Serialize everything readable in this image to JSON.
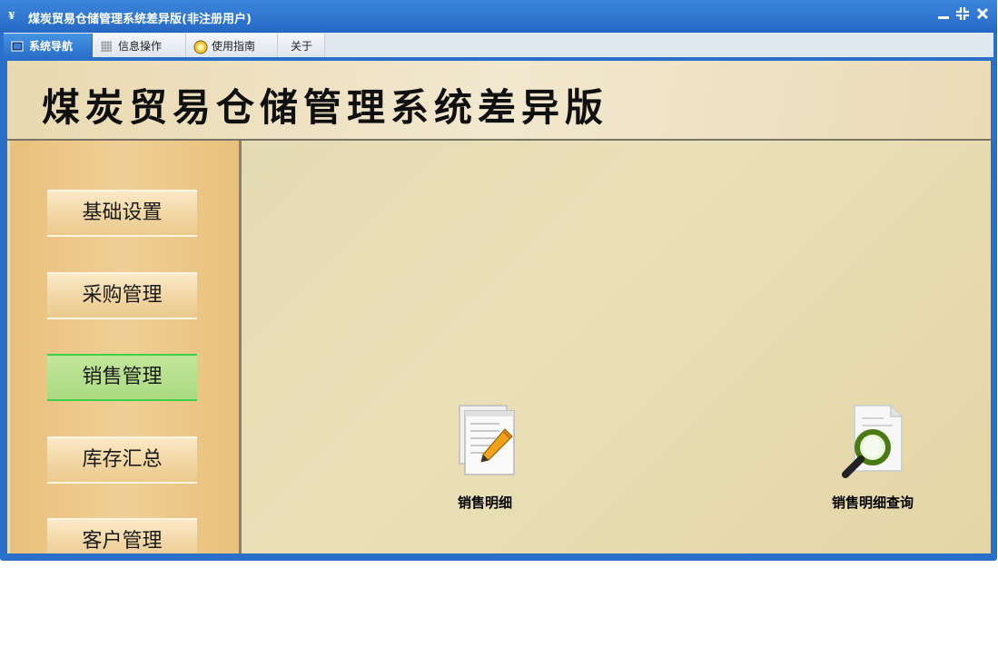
{
  "window": {
    "title": "煤炭贸易仓储管理系统差异版(非注册用户)",
    "controls": [
      "minimize-icon",
      "restore-icon",
      "close-icon"
    ]
  },
  "menu": {
    "tabs": [
      {
        "label": "系统导航",
        "icon": "monitor-icon",
        "active": true
      },
      {
        "label": "信息操作",
        "icon": "grid-icon",
        "active": false
      },
      {
        "label": "使用指南",
        "icon": "lightbulb-icon",
        "active": false
      },
      {
        "label": "关于",
        "icon": "",
        "active": false
      }
    ]
  },
  "banner": {
    "title": "煤炭贸易仓储管理系统差异版"
  },
  "sidebar": {
    "items": [
      {
        "label": "基础设置",
        "active": false
      },
      {
        "label": "采购管理",
        "active": false
      },
      {
        "label": "销售管理",
        "active": true
      },
      {
        "label": "库存汇总",
        "active": false
      },
      {
        "label": "客户管理",
        "active": false
      }
    ]
  },
  "main": {
    "functions": [
      {
        "label": "销售明细",
        "icon": "document-edit-icon"
      },
      {
        "label": "销售明细查询",
        "icon": "magnifier-document-icon"
      }
    ]
  },
  "colors": {
    "window_blue": "#2a6fc9",
    "banner_bg": "#f2e8cf",
    "sidebar_bg": "#efcf96",
    "active_item": "#a9d980",
    "main_bg": "#eae0b8"
  }
}
